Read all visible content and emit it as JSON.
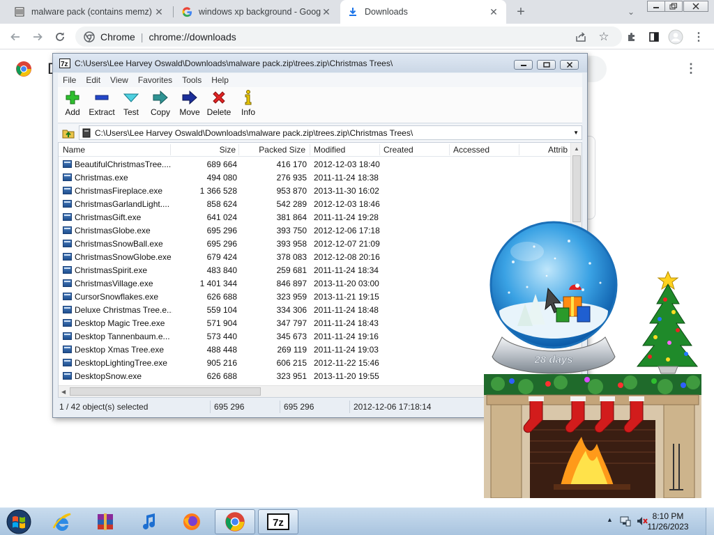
{
  "browser": {
    "tabs": [
      {
        "title": "malware pack (contains memz) :",
        "icon": "archive-icon"
      },
      {
        "title": "windows xp background - Googl",
        "icon": "google-g-icon"
      },
      {
        "title": "Downloads",
        "icon": "download-icon"
      }
    ],
    "omnibox": {
      "site_label": "Chrome",
      "url": "chrome://downloads"
    }
  },
  "downloads_page": {
    "title_initial": "D"
  },
  "zip_window": {
    "title": "C:\\Users\\Lee Harvey Oswald\\Downloads\\malware pack.zip\\trees.zip\\Christmas Trees\\",
    "menu": [
      "File",
      "Edit",
      "View",
      "Favorites",
      "Tools",
      "Help"
    ],
    "toolbar": [
      {
        "label": "Add",
        "icon": "add-plus-icon",
        "color": "#22a822"
      },
      {
        "label": "Extract",
        "icon": "extract-minus-icon",
        "color": "#1f3fbf"
      },
      {
        "label": "Test",
        "icon": "test-check-icon",
        "color": "#2bb3c9"
      },
      {
        "label": "Copy",
        "icon": "copy-arrow-icon",
        "color": "#2a8a8a"
      },
      {
        "label": "Move",
        "icon": "move-arrow-icon",
        "color": "#1c2f8f"
      },
      {
        "label": "Delete",
        "icon": "delete-x-icon",
        "color": "#d82020"
      },
      {
        "label": "Info",
        "icon": "info-icon",
        "color": "#d9b800"
      }
    ],
    "address": "C:\\Users\\Lee Harvey Oswald\\Downloads\\malware pack.zip\\trees.zip\\Christmas Trees\\",
    "columns": [
      "Name",
      "Size",
      "Packed Size",
      "Modified",
      "Created",
      "Accessed",
      "Attrib"
    ],
    "files": [
      {
        "name": "BeautifulChristmasTree....",
        "size": "689 664",
        "packed": "416 170",
        "modified": "2012-12-03 18:40"
      },
      {
        "name": "Christmas.exe",
        "size": "494 080",
        "packed": "276 935",
        "modified": "2011-11-24 18:38"
      },
      {
        "name": "ChristmasFireplace.exe",
        "size": "1 366 528",
        "packed": "953 870",
        "modified": "2013-11-30 16:02"
      },
      {
        "name": "ChristmasGarlandLight....",
        "size": "858 624",
        "packed": "542 289",
        "modified": "2012-12-03 18:46"
      },
      {
        "name": "ChristmasGift.exe",
        "size": "641 024",
        "packed": "381 864",
        "modified": "2011-11-24 19:28"
      },
      {
        "name": "ChristmasGlobe.exe",
        "size": "695 296",
        "packed": "393 750",
        "modified": "2012-12-06 17:18"
      },
      {
        "name": "ChristmasSnowBall.exe",
        "size": "695 296",
        "packed": "393 958",
        "modified": "2012-12-07 21:09"
      },
      {
        "name": "ChristmasSnowGlobe.exe",
        "size": "679 424",
        "packed": "378 083",
        "modified": "2012-12-08 20:16"
      },
      {
        "name": "ChristmasSpirit.exe",
        "size": "483 840",
        "packed": "259 681",
        "modified": "2011-11-24 18:34"
      },
      {
        "name": "ChristmasVillage.exe",
        "size": "1 401 344",
        "packed": "846 897",
        "modified": "2013-11-20 03:00"
      },
      {
        "name": "CursorSnowflakes.exe",
        "size": "626 688",
        "packed": "323 959",
        "modified": "2013-11-21 19:15"
      },
      {
        "name": "Deluxe Christmas Tree.e...",
        "size": "559 104",
        "packed": "334 306",
        "modified": "2011-11-24 18:48"
      },
      {
        "name": "Desktop Magic Tree.exe",
        "size": "571 904",
        "packed": "347 797",
        "modified": "2011-11-24 18:43"
      },
      {
        "name": "Desktop Tannenbaum.e...",
        "size": "573 440",
        "packed": "345 673",
        "modified": "2011-11-24 19:16"
      },
      {
        "name": "Desktop Xmas Tree.exe",
        "size": "488 448",
        "packed": "269 119",
        "modified": "2011-11-24 19:03"
      },
      {
        "name": "DesktopLightingTree.exe",
        "size": "905 216",
        "packed": "606 215",
        "modified": "2012-11-22 15:46"
      },
      {
        "name": "DesktopSnow.exe",
        "size": "626 688",
        "packed": "323 951",
        "modified": "2013-11-20 19:55"
      }
    ],
    "status": {
      "selection": "1 / 42 object(s) selected",
      "size": "695 296",
      "packed": "695 296",
      "modified": "2012-12-06 17:18:14"
    }
  },
  "desktop": {
    "globe_label": "28 days"
  },
  "taskbar": {
    "apps": [
      {
        "name": "internet-explorer",
        "icon": "internet-explorer-icon"
      },
      {
        "name": "winrar",
        "icon": "winrar-icon"
      },
      {
        "name": "itunes",
        "icon": "music-note-icon"
      },
      {
        "name": "firefox",
        "icon": "firefox-icon"
      },
      {
        "name": "chrome",
        "icon": "chrome-icon"
      },
      {
        "name": "7zip",
        "icon": "sevenzip-icon",
        "label": "7z"
      }
    ],
    "clock": {
      "time": "8:10 PM",
      "date": "11/26/2023"
    }
  }
}
